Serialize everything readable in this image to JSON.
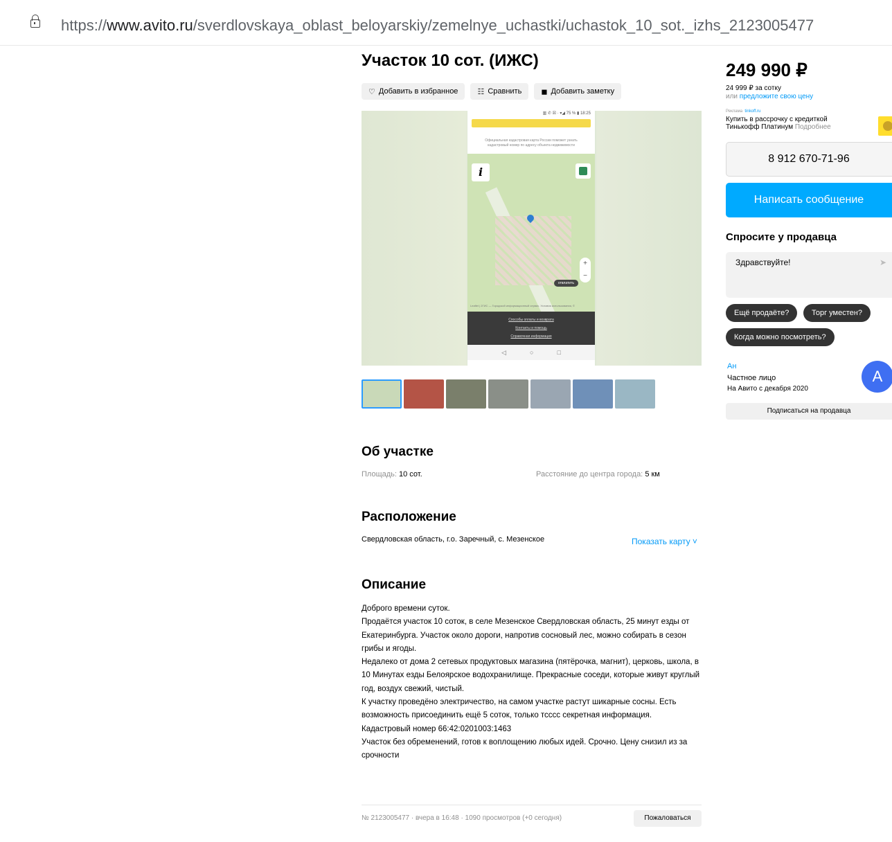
{
  "browser": {
    "url_prefix": "https://",
    "url_host": "www.avito.ru",
    "url_path": "/sverdlovskaya_oblast_beloyarskiy/zemelnye_uchastki/uchastok_10_sot._izhs_2123005477"
  },
  "listing": {
    "title": "Участок 10 сот. (ИЖС)",
    "actions": {
      "favorite": "Добавить в избранное",
      "compare": "Сравнить",
      "note": "Добавить заметку"
    }
  },
  "gallery": {
    "phone_status": "▥ ✆ ☒ · ▾◢ 75 % ▮ 18:25",
    "phone_info": "Официальная кадастровая карта России поможет узнать кадастровый номер по адресу объекта недвижимости",
    "map_info_button": "i",
    "map_tag": "отвлатить",
    "map_credit": "Leaflet | 2ГИС — Городской информационный сервис. Условия использования, ©",
    "footer_links": [
      "Способы оплаты и возврата",
      "Контакты и помощь",
      "Справочная информация"
    ],
    "nav_icons": [
      "◁",
      "○",
      "□"
    ],
    "thumb_colors": [
      "#c9d9b8",
      "#b45446",
      "#7a7f6b",
      "#8a8f88",
      "#9aa6b2",
      "#6f90b8",
      "#9ab7c4"
    ]
  },
  "about": {
    "heading": "Об участке",
    "area_label": "Площадь:",
    "area_value": "10 сот.",
    "distance_label": "Расстояние до центра города:",
    "distance_value": "5 км"
  },
  "location": {
    "heading": "Расположение",
    "address": "Свердловская область, г.о. Заречный, с. Мезенское",
    "show_map": "Показать карту ˅"
  },
  "description": {
    "heading": "Описание",
    "lines": [
      "Доброго времени суток.",
      "Продаётся участок 10 соток, в селе Мезенское Свердловская область, 25 минут езды от Екатеринбурга. Участок около дороги, напротив сосновый лес, можно собирать в сезон грибы и ягоды.",
      "Недалеко от дома 2 сетевых продуктовых магазина (пятёрочка, магнит), церковь, школа, в 10 Минутах езды Белоярское водохранилище. Прекрасные соседи, которые живут круглый год, воздух свежий, чистый.",
      "К участку проведёно электричество, на самом участке растут шикарные сосны. Есть возможность присоединить ещё 5 соток, только тсссс секретная информация.",
      "Кадастровый номер 66:42:0201003:1463",
      "Участок без обременений, готов к воплощению любых идей. Срочно. Цену снизил из за срочности"
    ]
  },
  "footer": {
    "meta": "№ 2123005477 · вчера в 16:48 · 1090 просмотров (+0 сегодня)",
    "report": "Пожаловаться"
  },
  "sidebar": {
    "price": "249 990 ₽",
    "price_per_unit": "24 999 ₽ за сотку",
    "offer_prefix": "или ",
    "offer_link": "предложите свою цену",
    "ad_label": "Реклама",
    "ad_domain": "tinkoff.ru",
    "ad_text_1": "Купить в рассрочку с кредиткой",
    "ad_text_2": "Тинькофф Платинум",
    "ad_more": " Подробнее",
    "phone": "8 912 670-71-96",
    "message_button": "Написать сообщение",
    "ask_title": "Спросите у продавца",
    "ask_text": "Здравствуйте!",
    "ask_send": "➤",
    "chips": [
      "Ещё продаёте?",
      "Торг уместен?",
      "Когда можно посмотреть?"
    ],
    "seller_name": "Ан",
    "seller_type": "Частное лицо",
    "seller_since": "На Авито с декабря 2020",
    "avatar_letter": "A",
    "subscribe": "Подписаться на продавца"
  },
  "colors": {
    "accent": "#00aaff",
    "link": "#0099f7",
    "avatar": "#3f6ff2"
  }
}
